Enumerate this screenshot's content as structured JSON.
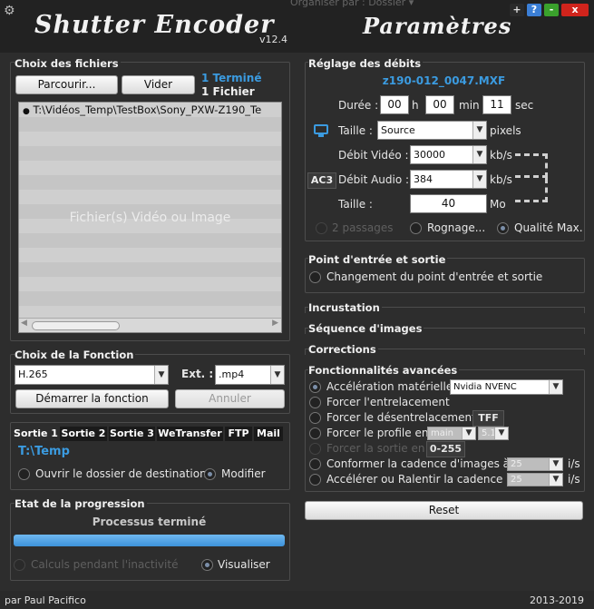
{
  "window": {
    "app_title": "Shutter Encoder",
    "version": "v12.4",
    "params_title": "Paramètres",
    "ghost_text": "Organiser par :    Dossier ▾",
    "buttons": {
      "plus": "+",
      "help": "?",
      "minimize": "-",
      "close": "x"
    }
  },
  "files": {
    "title": "Choix des fichiers",
    "browse_label": "Parcourir...",
    "clear_label": "Vider",
    "done_count": "1 Terminé",
    "file_count": "1 Fichier",
    "items": [
      "T:\\Vidéos_Temp\\TestBox\\Sony_PXW-Z190_Te"
    ],
    "placeholder": "Fichier(s) Vidéo ou Image"
  },
  "function": {
    "title": "Choix de la Fonction",
    "selected": "H.265",
    "ext_label": "Ext. :",
    "ext_value": ".mp4",
    "start_label": "Démarrer la fonction",
    "cancel_label": "Annuler"
  },
  "output": {
    "tabs": [
      "Sortie 1",
      "Sortie 2",
      "Sortie 3",
      "WeTransfer",
      "FTP",
      "Mail"
    ],
    "path": "T:\\Temp",
    "open_folder": "Ouvrir le dossier de destination",
    "modify": "Modifier"
  },
  "progress": {
    "title": "Etat de la progression",
    "status": "Processus terminé",
    "value": 1.0,
    "idle_calc": "Calculs pendant l'inactivité",
    "visualize": "Visualiser"
  },
  "bitrate": {
    "title": "Réglage des débits",
    "filename": "z190-012_0047.MXF",
    "duration_label": "Durée :",
    "hours": "00",
    "h": "h",
    "minutes": "00",
    "min": "min",
    "seconds": "11",
    "sec": "sec",
    "size_label": "Taille :",
    "size_value": "Source",
    "pixels": "pixels",
    "video_label": "Débit Vidéo :",
    "video_value": "30000",
    "kbs": "kb/s",
    "ac3": "AC3",
    "audio_label": "Débit Audio :",
    "audio_value": "384",
    "file_size_label": "Taille :",
    "file_size_value": "40",
    "mo": "Mo",
    "two_pass": "2 passages",
    "crop": "Rognage...",
    "max_quality": "Qualité Max."
  },
  "inout": {
    "title": "Point d'entrée et sortie",
    "change": "Changement du point d'entrée et sortie"
  },
  "sections": {
    "overlay": "Incrustation",
    "image_seq": "Séquence d'images",
    "corrections": "Corrections"
  },
  "advanced": {
    "title": "Fonctionnalités avancées",
    "hw_accel": "Accélération matérielle :",
    "hw_value": "Nvidia NVENC",
    "force_interlace": "Forcer l'entrelacement",
    "force_deinterlace": "Forcer le désentrelacement :",
    "tff": "TFF",
    "force_profile": "Forcer le profile en :",
    "profile": "main",
    "level": "5.1",
    "force_output": "Forcer la sortie en :",
    "range": "0-255",
    "conform_rate": "Conformer la cadence d'images à :",
    "conform_value": "25",
    "speed_rate": "Accélérer ou Ralentir la cadence à :",
    "speed_value": "25",
    "fps": "i/s"
  },
  "reset_label": "Reset",
  "footer": {
    "author": "par Paul Pacifico",
    "years": "2013-2019"
  },
  "colors": {
    "accent": "#3b9be0",
    "progress": "#4ea3e8",
    "background": "#2d2d2d"
  }
}
